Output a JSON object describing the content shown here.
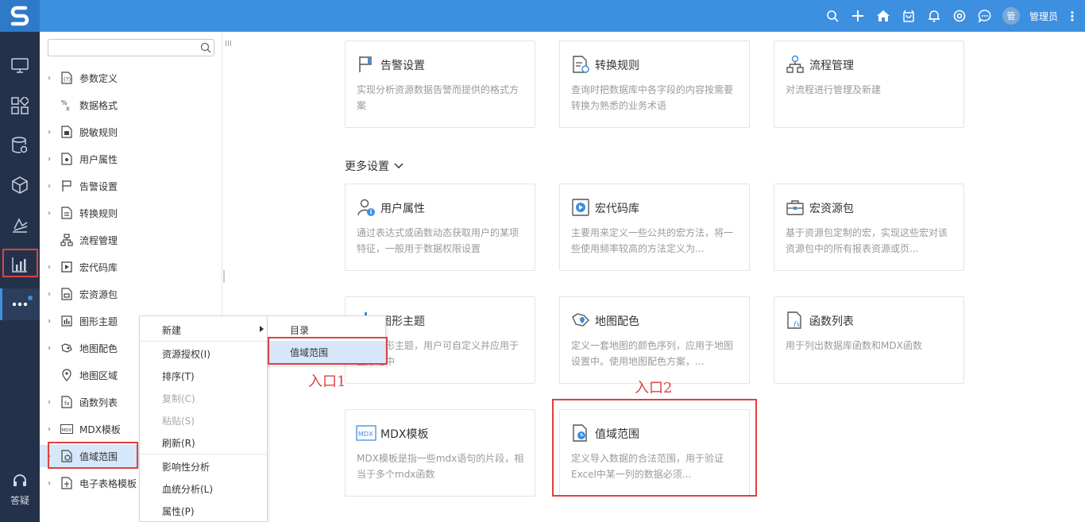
{
  "header": {
    "user_avatar_text": "管",
    "user_name": "管理员",
    "icons": [
      "search-icon",
      "plus-icon",
      "home-icon",
      "bag-icon",
      "bell-icon",
      "settings-icon",
      "chat-icon"
    ]
  },
  "nav": {
    "items": [
      "monitor-icon",
      "apps-icon",
      "database-icon",
      "cube-icon",
      "analysis-icon",
      "chart-icon",
      "more-icon"
    ],
    "help_label": "答疑"
  },
  "tree": {
    "items": [
      {
        "label": "参数定义",
        "has_arrow": true
      },
      {
        "label": "数据格式",
        "has_arrow": false
      },
      {
        "label": "脱敏规则",
        "has_arrow": true
      },
      {
        "label": "用户属性",
        "has_arrow": true
      },
      {
        "label": "告警设置",
        "has_arrow": true
      },
      {
        "label": "转换规则",
        "has_arrow": true
      },
      {
        "label": "流程管理",
        "has_arrow": false
      },
      {
        "label": "宏代码库",
        "has_arrow": true
      },
      {
        "label": "宏资源包",
        "has_arrow": true
      },
      {
        "label": "图形主题",
        "has_arrow": true
      },
      {
        "label": "地图配色",
        "has_arrow": true
      },
      {
        "label": "地图区域",
        "has_arrow": false
      },
      {
        "label": "函数列表",
        "has_arrow": true
      },
      {
        "label": "MDX模板",
        "has_arrow": true
      },
      {
        "label": "值域范围",
        "has_arrow": true
      },
      {
        "label": "电子表格模板",
        "has_arrow": true
      }
    ]
  },
  "cards_top": [
    {
      "title": "告警设置",
      "desc": "实现分析资源数据告警而提供的格式方案"
    },
    {
      "title": "转换规则",
      "desc": "查询时把数据库中各字段的内容按需要转换为熟悉的业务术语"
    },
    {
      "title": "流程管理",
      "desc": "对流程进行管理及新建"
    }
  ],
  "more_settings_label": "更多设置",
  "cards_more": [
    {
      "title": "用户属性",
      "desc": "通过表达式或函数动态获取用户的某项特征，一般用于数据权限设置"
    },
    {
      "title": "宏代码库",
      "desc": "主要用来定义一些公共的宏方法，将一些使用频率较高的方法定义为..."
    },
    {
      "title": "宏资源包",
      "desc": "基于资源包定制的宏，实现这些宏对该资源包中的所有报表资源或页..."
    },
    {
      "title": "图形主题",
      "desc": "一些图形主题，用户可自定义并应用于图形之中"
    },
    {
      "title": "地图配色",
      "desc": "定义一套地图的颜色序列，应用于地图设置中。使用地图配色方案，..."
    },
    {
      "title": "函数列表",
      "desc": "用于列出数据库函数和MDX函数"
    },
    {
      "title": "MDX模板",
      "desc": "MDX模板是指一些mdx语句的片段，相当于多个mdx函数"
    },
    {
      "title": "值域范围",
      "desc": "定义导入数据的合法范围，用于验证Excel中某一列的数据必须..."
    }
  ],
  "context_menu": {
    "items": [
      "新建",
      "资源授权(I)",
      "排序(T)",
      "复制(C)",
      "粘贴(S)",
      "刷新(R)",
      "影响性分析",
      "血统分析(L)",
      "属性(P)"
    ],
    "submenu": [
      "目录",
      "值域范围"
    ]
  },
  "annotations": {
    "entry1": "入口1",
    "entry2": "入口2"
  },
  "colors": {
    "topbar": "#3d8fe0",
    "nav": "#23324a",
    "highlight": "#e04040",
    "selected": "#d6e7f9"
  }
}
